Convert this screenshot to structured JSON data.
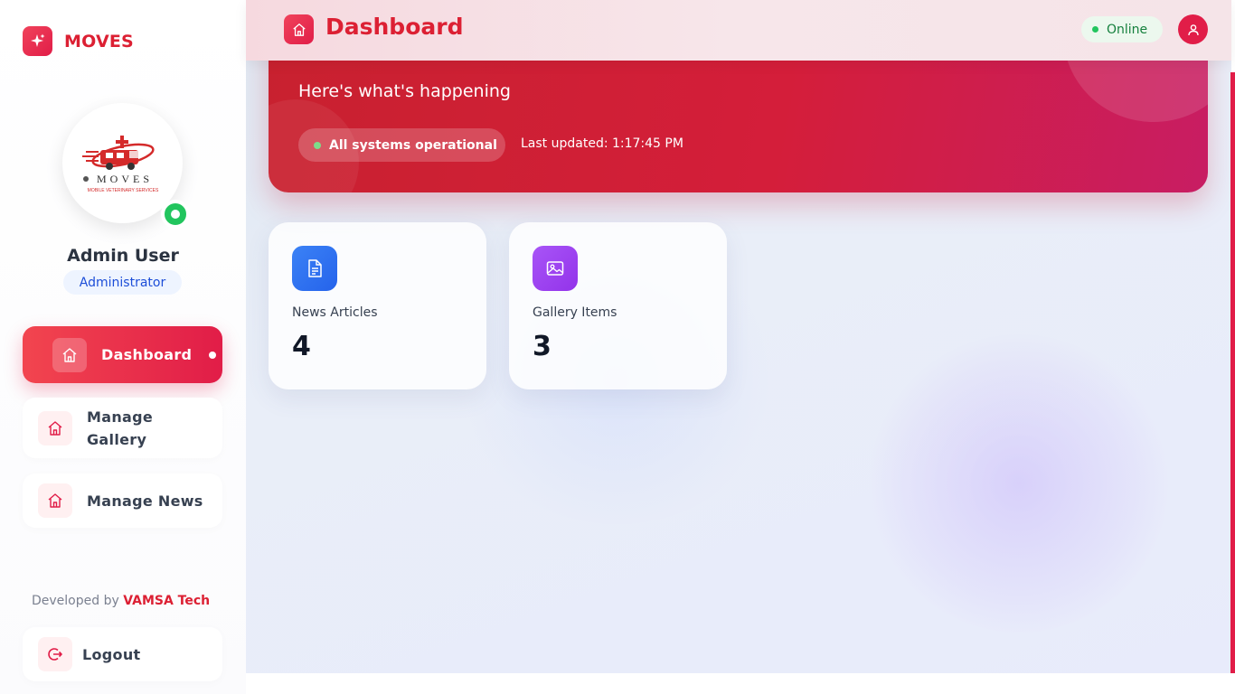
{
  "brand": {
    "name": "MOVES",
    "icon": "sparkle-icon"
  },
  "profile": {
    "logo_text": "MOVES",
    "logo_tagline": "MOBILE VETERINARY SERVICES",
    "name": "Admin User",
    "role": "Administrator",
    "status": "online"
  },
  "sidebar": {
    "items": [
      {
        "label": "Dashboard",
        "icon": "home-icon",
        "active": true
      },
      {
        "label": "Manage Gallery",
        "icon": "home-icon",
        "active": false
      },
      {
        "label": "Manage News",
        "icon": "home-icon",
        "active": false
      }
    ],
    "credit_prefix": "Developed by",
    "credit_name": "VAMSA Tech",
    "logout_label": "Logout"
  },
  "header": {
    "title": "Dashboard",
    "icon": "home-icon",
    "status_label": "Online"
  },
  "hero": {
    "subtitle": "Here's what's happening",
    "status_text": "All systems operational",
    "last_updated": "Last updated: 1:17:45 PM"
  },
  "stats": [
    {
      "label": "News Articles",
      "value": "4",
      "icon": "document-icon",
      "color": "#2f6ff0"
    },
    {
      "label": "Gallery Items",
      "value": "3",
      "icon": "image-icon",
      "color": "#9333ea"
    }
  ],
  "colors": {
    "accent": "#dc2033",
    "online": "#22c55e"
  }
}
